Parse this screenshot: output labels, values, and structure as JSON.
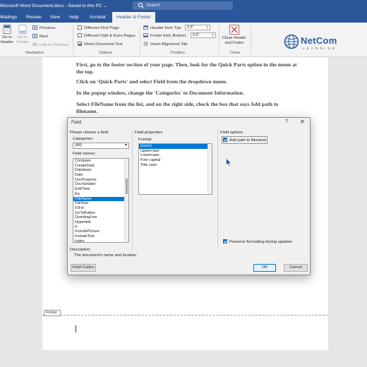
{
  "titlebar": {
    "doc_title": "Microsoft Word Document.docx  -  Saved to this PC  ⌄",
    "search_placeholder": "Search"
  },
  "tabs": [
    "Mailings",
    "Review",
    "View",
    "Help",
    "Acrobat",
    "Header & Footer"
  ],
  "ribbon": {
    "navigation": {
      "go_to_header": "Go to Header",
      "go_to_footer": "Go to Footer",
      "previous": "Previous",
      "next": "Next",
      "link_to_previous": "Link to Previous",
      "group_label": "Navigation"
    },
    "options": {
      "different_first_page": "Different First Page",
      "different_odd_even": "Different Odd & Even Pages",
      "show_document_text": "Show Document Text",
      "group_label": "Options"
    },
    "position": {
      "header_from_top_label": "Header from Top:",
      "header_from_top_value": "0.5\"",
      "footer_from_bottom_label": "Footer from Bottom:",
      "footer_from_bottom_value": "0.5\"",
      "insert_alignment_tab": "Insert Alignment Tab",
      "group_label": "Position"
    },
    "close": {
      "close_button": "Close Header and Footer",
      "group_label": "Close"
    }
  },
  "logo": {
    "wordmark": "NetCom",
    "sub": "LEARNING"
  },
  "document": {
    "lines": [
      "First, go to the footer section of your page. Then, look for the Quick Parts option in the menu at the top.",
      "Click on 'Quick Parts' and select Field from the dropdown menu.",
      "In the popup window, change the 'Categories' to Document Information.",
      "Select FileName from the list, and on the right side, check the box that says Add path to filename."
    ],
    "footer_tag": "Footer"
  },
  "dialog": {
    "title": "Field",
    "help": "?",
    "close": "✕",
    "choose_heading": "Please choose a field",
    "categories_label": "Categories:",
    "categories_value": "(All)",
    "field_names_label": "Field names:",
    "field_names": [
      "Compare",
      "CreateDate",
      "Database",
      "Date",
      "DocProperty",
      "DocVariable",
      "EditTime",
      "Eq",
      "FileName",
      "FileSize",
      "Fill-in",
      "GoToButton",
      "GreetingLine",
      "Hyperlink",
      "If",
      "IncludePicture",
      "IncludeText",
      "Index"
    ],
    "selected_field": "FileName",
    "properties_heading": "Field properties",
    "format_label": "Format:",
    "formats": [
      "(none)",
      "Uppercase",
      "Lowercase",
      "First capital",
      "Title case"
    ],
    "selected_format": "(none)",
    "options_heading": "Field options",
    "add_path_label": "Add path to filename",
    "preserve_label": "Preserve formatting during updates",
    "description_label": "Description:",
    "description_text": "The document's name and location",
    "field_codes_button": "Field Codes",
    "ok_button": "OK",
    "cancel_button": "Cancel"
  }
}
